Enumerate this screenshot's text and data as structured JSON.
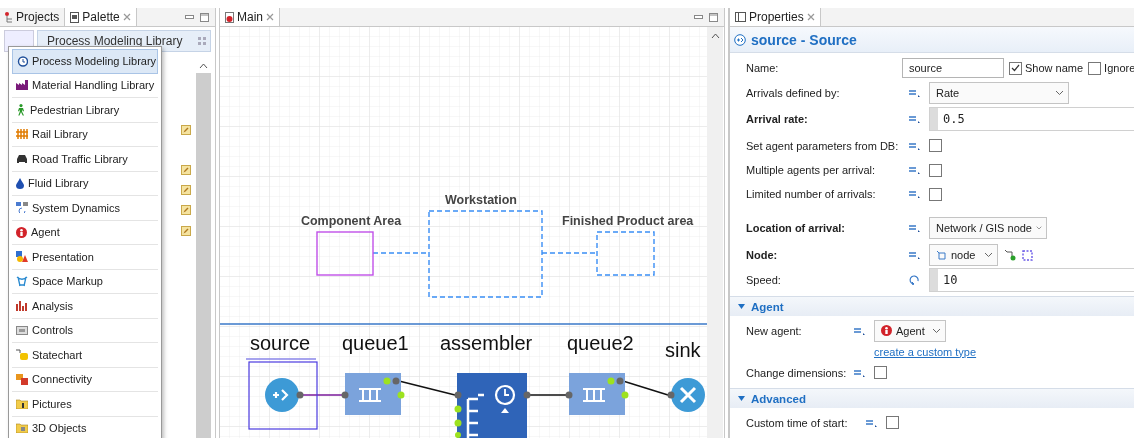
{
  "palette_panel": {
    "tabs": [
      {
        "label": "Projects",
        "selected": false
      },
      {
        "label": "Palette",
        "selected": true
      }
    ],
    "header": "Process Modeling Library",
    "menu": [
      {
        "label": "Process Modeling Library",
        "selected": true
      },
      {
        "label": "Material Handling Library",
        "selected": false
      },
      {
        "label": "Pedestrian Library",
        "selected": false
      },
      {
        "label": "Rail Library",
        "selected": false
      },
      {
        "label": "Road Traffic Library",
        "selected": false
      },
      {
        "label": "Fluid Library",
        "selected": false
      },
      {
        "label": "System Dynamics",
        "selected": false
      },
      {
        "label": "Agent",
        "selected": false
      },
      {
        "label": "Presentation",
        "selected": false
      },
      {
        "label": "Space Markup",
        "selected": false
      },
      {
        "label": "Analysis",
        "selected": false
      },
      {
        "label": "Controls",
        "selected": false
      },
      {
        "label": "Statechart",
        "selected": false
      },
      {
        "label": "Connectivity",
        "selected": false
      },
      {
        "label": "Pictures",
        "selected": false
      },
      {
        "label": "3D Objects",
        "selected": false
      }
    ]
  },
  "main_panel": {
    "tab": {
      "label": "Main",
      "selected": true
    },
    "areas": [
      {
        "label": "Component Area",
        "selected": true
      },
      {
        "label": "Workstation",
        "selected": false
      },
      {
        "label": "Finished Product area",
        "selected": false
      }
    ],
    "blocks": [
      {
        "label": "source",
        "kind": "source",
        "selected": true
      },
      {
        "label": "queue1",
        "kind": "queue",
        "selected": false
      },
      {
        "label": "assembler",
        "kind": "assembler",
        "selected": false
      },
      {
        "label": "queue2",
        "kind": "queue",
        "selected": false
      },
      {
        "label": "sink",
        "kind": "sink",
        "selected": false
      }
    ]
  },
  "properties_panel": {
    "tab": {
      "label": "Properties",
      "selected": true
    },
    "title": "source - Source",
    "groups": [
      [
        {
          "kind": "name",
          "label": "Name:",
          "value": "source",
          "checks": [
            {
              "label": "Show name",
              "checked": true
            },
            {
              "label": "Ignore",
              "checked": false
            }
          ]
        },
        {
          "kind": "select",
          "label": "Arrivals defined by:",
          "value": "Rate",
          "bold": false,
          "dynamic": false
        },
        {
          "kind": "code",
          "label": "Arrival rate:",
          "value": "0.5",
          "bold": true,
          "dynamic": false
        },
        {
          "kind": "checkbox",
          "label": "Set agent parameters from DB:",
          "checked": false,
          "bold": false,
          "dynamic": false
        },
        {
          "kind": "checkbox",
          "label": "Multiple agents per arrival:",
          "checked": false,
          "bold": false,
          "dynamic": false
        },
        {
          "kind": "checkbox",
          "label": "Limited number of arrivals:",
          "checked": false,
          "bold": false,
          "dynamic": false
        }
      ],
      [
        {
          "kind": "select",
          "label": "Location of arrival:",
          "value": "Network / GIS node",
          "bold": true,
          "dynamic": false
        },
        {
          "kind": "node-select",
          "label": "Node:",
          "value": "node",
          "bold": true,
          "dynamic": false
        },
        {
          "kind": "code",
          "label": "Speed:",
          "value": "10",
          "bold": false,
          "dynamic": true
        }
      ]
    ],
    "sections": [
      {
        "title": "Agent",
        "expanded": true,
        "rows": [
          {
            "kind": "agent-select",
            "label": "New agent:",
            "value": "Agent",
            "bold": false,
            "dynamic": false
          },
          {
            "kind": "link",
            "value": "create a custom type"
          },
          {
            "kind": "checkbox",
            "label": "Change dimensions:",
            "checked": false,
            "bold": false,
            "dynamic": false
          }
        ]
      },
      {
        "title": "Advanced",
        "expanded": true,
        "rows": [
          {
            "kind": "checkbox",
            "label": "Custom time of start:",
            "checked": false,
            "bold": false,
            "dynamic": false
          }
        ]
      }
    ]
  }
}
